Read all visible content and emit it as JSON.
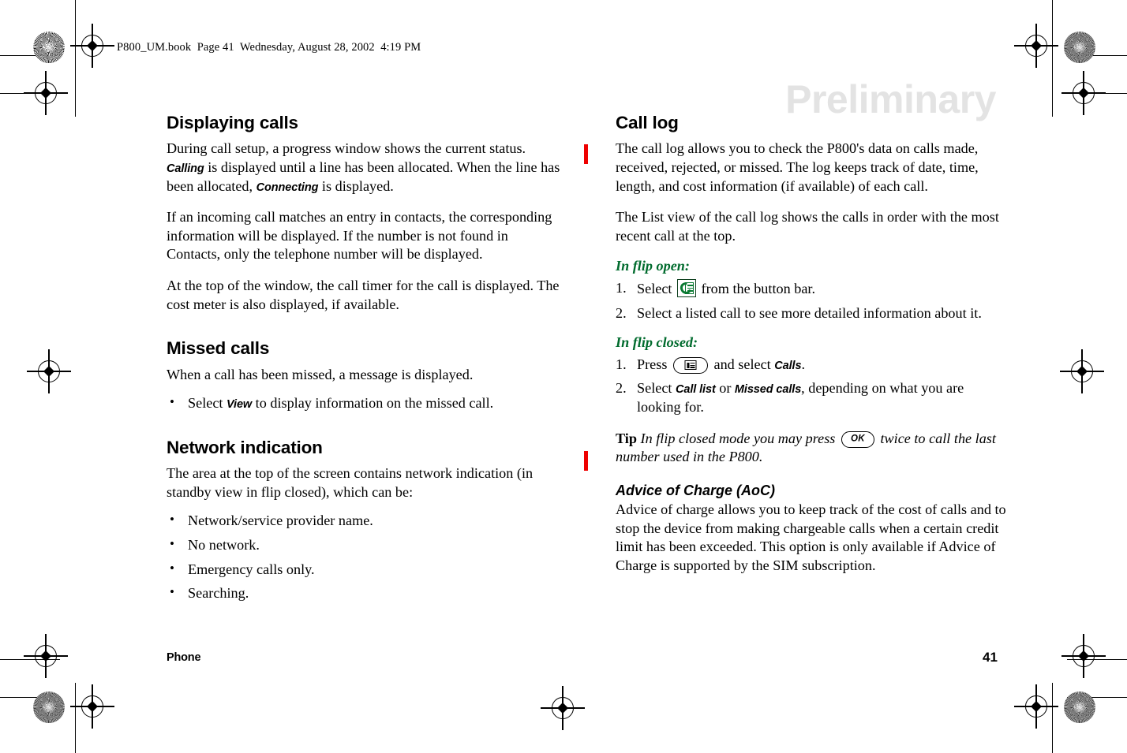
{
  "slug": {
    "text": "P800_UM.book  Page 41  Wednesday, August 28, 2002  4:19 PM"
  },
  "watermark": {
    "text": "Preliminary",
    "color": "#e3e3e3"
  },
  "colors": {
    "change_bar": "#ee0000",
    "green_heading": "#006b2d",
    "icon_green": "#0a7a32"
  },
  "left_column": {
    "sections": [
      {
        "heading": "Displaying calls",
        "paragraphs": [
          {
            "runs": [
              {
                "t": "During call setup, a progress window shows the current status. ",
                "s": "normal"
              },
              {
                "t": "Calling",
                "s": "ui"
              },
              {
                "t": " is displayed until a line has been allocated. When the line has been allocated, ",
                "s": "normal"
              },
              {
                "t": "Connecting",
                "s": "ui"
              },
              {
                "t": " is displayed.",
                "s": "normal"
              }
            ]
          },
          {
            "runs": [
              {
                "t": "If an incoming call matches an entry in contacts, the corresponding information will be displayed. If the number is not found in Contacts, only the telephone number will be displayed.",
                "s": "normal"
              }
            ]
          },
          {
            "runs": [
              {
                "t": "At the top of the window, the call timer for the call is displayed. The cost meter is also displayed, if available.",
                "s": "normal"
              }
            ]
          }
        ]
      },
      {
        "heading": "Missed calls",
        "paragraphs": [
          {
            "runs": [
              {
                "t": "When a call has been missed, a message is displayed.",
                "s": "normal"
              }
            ]
          }
        ],
        "bullets": [
          {
            "runs": [
              {
                "t": "Select ",
                "s": "normal"
              },
              {
                "t": "View",
                "s": "ui"
              },
              {
                "t": " to display information on the missed call.",
                "s": "normal"
              }
            ]
          }
        ]
      },
      {
        "heading": "Network indication",
        "paragraphs": [
          {
            "runs": [
              {
                "t": "The area at the top of the screen contains network indication (in standby view in flip closed), which can be:",
                "s": "normal"
              }
            ]
          }
        ],
        "bullets": [
          {
            "runs": [
              {
                "t": "Network/service provider name.",
                "s": "normal"
              }
            ]
          },
          {
            "runs": [
              {
                "t": "No network.",
                "s": "normal"
              }
            ]
          },
          {
            "runs": [
              {
                "t": "Emergency calls only.",
                "s": "normal"
              }
            ]
          },
          {
            "runs": [
              {
                "t": "Searching.",
                "s": "normal"
              }
            ]
          }
        ]
      }
    ]
  },
  "right_column": {
    "heading": "Call log",
    "paragraphs": [
      {
        "runs": [
          {
            "t": "The call log allows you to check the P800's data on calls made, received, rejected, or missed. The log keeps track of date, time, length, and cost information (if available) of each call.",
            "s": "normal"
          }
        ]
      },
      {
        "runs": [
          {
            "t": "The List view of the call log shows the calls in order with the most recent call at the top.",
            "s": "normal"
          }
        ]
      }
    ],
    "flip_open": {
      "heading": "In flip open:",
      "steps": [
        {
          "num": "1.",
          "runs": [
            {
              "t": "Select ",
              "s": "normal"
            },
            {
              "t": "",
              "s": "icon-calllog"
            },
            {
              "t": " from the button bar.",
              "s": "normal"
            }
          ]
        },
        {
          "num": "2.",
          "runs": [
            {
              "t": "Select a listed call to see more detailed information about it.",
              "s": "normal"
            }
          ]
        }
      ]
    },
    "flip_closed": {
      "heading": "In flip closed:",
      "steps": [
        {
          "num": "1.",
          "runs": [
            {
              "t": "Press ",
              "s": "normal"
            },
            {
              "t": "",
              "s": "key-menu"
            },
            {
              "t": " and select ",
              "s": "normal"
            },
            {
              "t": "Calls",
              "s": "ui"
            },
            {
              "t": ".",
              "s": "normal"
            }
          ]
        },
        {
          "num": "2.",
          "runs": [
            {
              "t": "Select ",
              "s": "normal"
            },
            {
              "t": "Call list",
              "s": "ui"
            },
            {
              "t": " or ",
              "s": "normal"
            },
            {
              "t": "Missed calls",
              "s": "ui"
            },
            {
              "t": ", depending on what you are looking for.",
              "s": "normal"
            }
          ]
        }
      ]
    },
    "tip": {
      "label": "Tip",
      "runs": [
        {
          "t": " In flip closed mode you may press ",
          "s": "italic"
        },
        {
          "t": "OK",
          "s": "key-ok"
        },
        {
          "t": " twice to call the last number used in the P800.",
          "s": "italic"
        }
      ]
    },
    "aoc": {
      "heading": "Advice of Charge (AoC)",
      "paragraph": "Advice of charge allows you to keep track of the cost of calls and to stop the device from making chargeable calls when a certain credit limit has been exceeded. This option is only available if Advice of Charge is supported by the SIM subscription."
    }
  },
  "footer": {
    "left": "Phone",
    "page_number": "41"
  }
}
